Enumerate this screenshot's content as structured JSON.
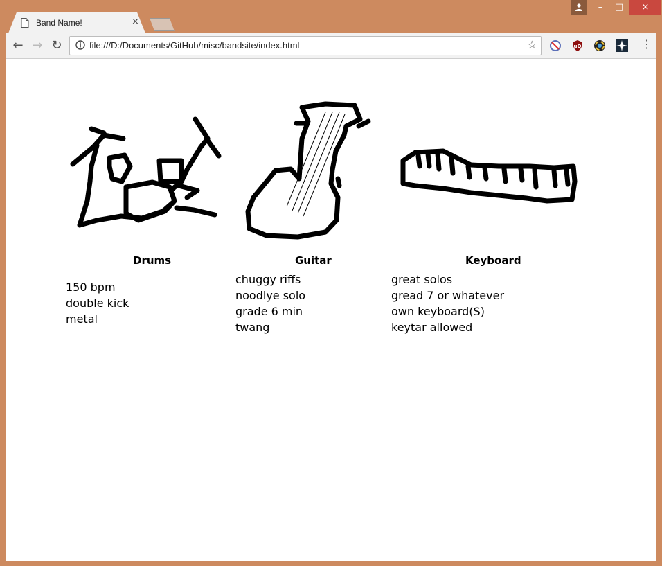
{
  "tab": {
    "title": "Band Name!",
    "close": "×"
  },
  "window": {
    "minimize": "–",
    "maximize": "□",
    "close": "×"
  },
  "toolbar": {
    "back": "←",
    "forward": "→",
    "reload": "↻",
    "menu": "⋮"
  },
  "omnibox": {
    "url": "file:///D:/Documents/GitHub/misc/bandsite/index.html"
  },
  "icons": {
    "page": "page-icon",
    "profile": "profile-icon",
    "info": "info-icon",
    "star": "star-icon",
    "ext1": "no-sign-icon",
    "ext2": "ublock-icon",
    "ext3": "color-wheel-icon",
    "ext4": "star-compass-icon"
  },
  "instruments": [
    {
      "name": "Drums",
      "notes": [
        "150 bpm",
        "double kick",
        "metal"
      ]
    },
    {
      "name": "Guitar",
      "notes": [
        "chuggy riffs",
        "noodlye solo",
        "grade 6 min",
        "twang"
      ]
    },
    {
      "name": "Keyboard",
      "notes": [
        "great solos",
        "gread 7 or whatever",
        "own keyboard(S)",
        "keytar allowed"
      ]
    }
  ],
  "colors": {
    "frame": "#cd8a5f",
    "close_red": "#c9483f",
    "ink": "#000000"
  }
}
